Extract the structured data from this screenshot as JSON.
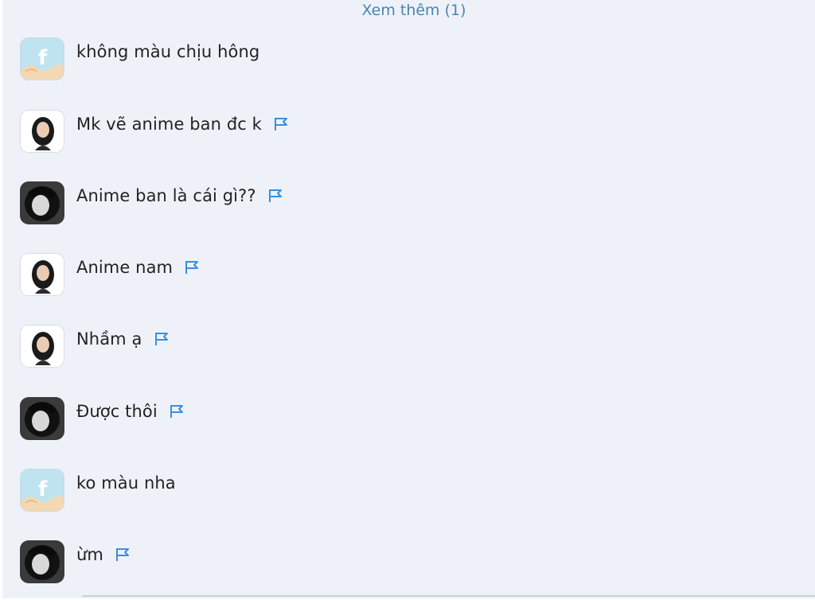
{
  "more_link": "Xem thêm (1)",
  "colors": {
    "panel_bg": "#eef2f8",
    "link": "#4a86b0",
    "flag": "#3a8ee0",
    "text": "#222222"
  },
  "comments": [
    {
      "avatar": "fb-icon-avatar",
      "text": "không màu chịu hông",
      "flag": false
    },
    {
      "avatar": "girl-avatar",
      "text": "Mk vẽ anime ban đc k",
      "flag": true
    },
    {
      "avatar": "dark-hair-avatar",
      "text": "Anime ban là cái gì??",
      "flag": true
    },
    {
      "avatar": "girl-avatar",
      "text": "Anime nam",
      "flag": true
    },
    {
      "avatar": "girl-avatar",
      "text": "Nhầm ạ",
      "flag": true
    },
    {
      "avatar": "dark-hair-avatar",
      "text": "Được thôi",
      "flag": true
    },
    {
      "avatar": "fb-icon-avatar",
      "text": "ko màu nha",
      "flag": false
    },
    {
      "avatar": "dark-hair-avatar",
      "text": "ừm",
      "flag": true
    }
  ]
}
